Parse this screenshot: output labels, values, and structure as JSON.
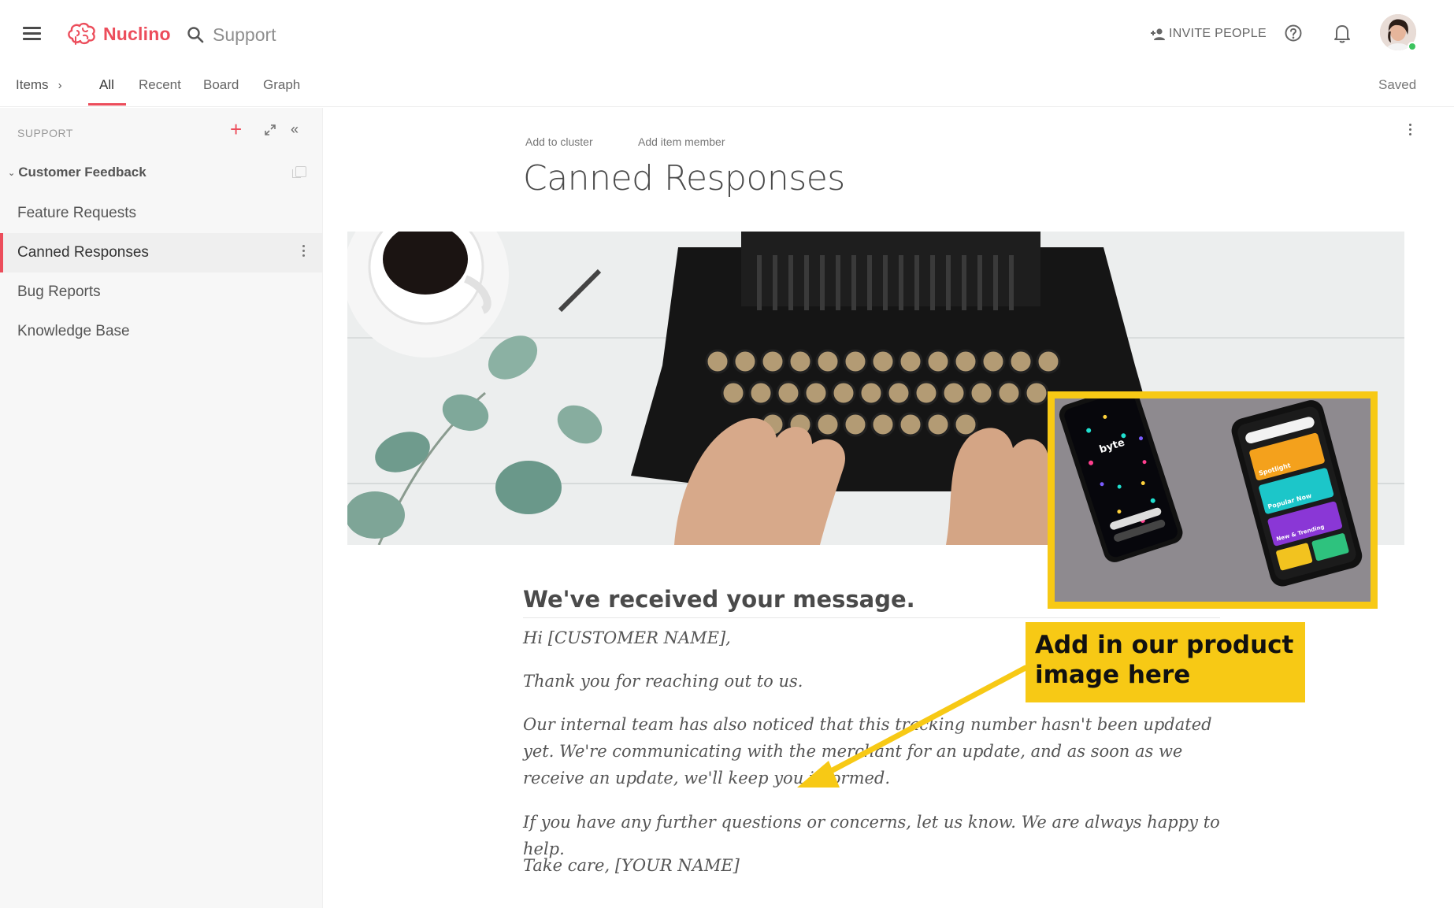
{
  "app": {
    "name": "Nuclino"
  },
  "search": {
    "placeholder": "Support"
  },
  "topbar": {
    "invite_label": "INVITE PEOPLE"
  },
  "nav": {
    "breadcrumb": "Items",
    "tabs": [
      {
        "label": "All",
        "active": true
      },
      {
        "label": "Recent"
      },
      {
        "label": "Board"
      },
      {
        "label": "Graph"
      }
    ],
    "status": "Saved"
  },
  "sidebar": {
    "workspace": "SUPPORT",
    "cluster": "Customer Feedback",
    "items": [
      {
        "label": "Feature Requests"
      },
      {
        "label": "Canned Responses",
        "active": true
      },
      {
        "label": "Bug Reports"
      },
      {
        "label": "Knowledge Base"
      }
    ]
  },
  "document": {
    "add_to_cluster": "Add to cluster",
    "add_item_member": "Add item member",
    "title": "Canned Responses",
    "heading": "We've received your message.",
    "paragraphs": [
      "Hi [CUSTOMER NAME],",
      "Thank you for reaching out to us.",
      "Our internal team has also noticed that this tracking number hasn't been updated yet. We're communicating with the merchant for an update, and as soon as we receive an update, we'll keep you informed.",
      "If you have any further questions or concerns, let us know. We are always happy to help.",
      "Take care, [YOUR NAME]"
    ]
  },
  "annotation": {
    "callout_line1": "Add in our product",
    "callout_line2": "image here",
    "product_app_label": "byte",
    "product_cards": [
      "Spotlight",
      "Popular Now",
      "New & Trending"
    ]
  },
  "colors": {
    "brand": "#ec4d5b",
    "annotation_yellow": "#f7c915",
    "online": "#3cc35e"
  }
}
